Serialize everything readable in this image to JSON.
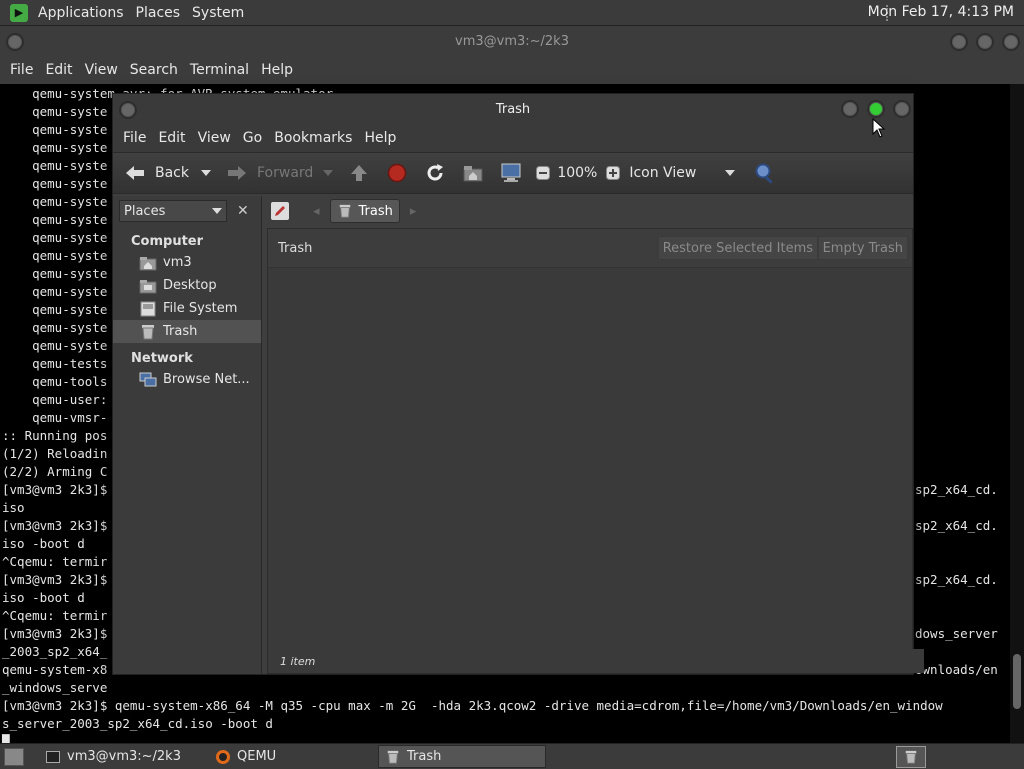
{
  "top_panel": {
    "menus": [
      "Applications",
      "Places",
      "System"
    ],
    "clock": "Mon Feb 17,  4:13 PM"
  },
  "terminal": {
    "title": "vm3@vm3:~/2k3",
    "menus": [
      "File",
      "Edit",
      "View",
      "Search",
      "Terminal",
      "Help"
    ],
    "lines_left": [
      "    qemu-system-avr: for AVR system emulator",
      "    qemu-syste",
      "    qemu-syste",
      "    qemu-syste",
      "    qemu-syste",
      "    qemu-syste",
      "    qemu-syste",
      "    qemu-syste",
      "    qemu-syste",
      "    qemu-syste",
      "    qemu-syste",
      "    qemu-syste",
      "    qemu-syste",
      "    qemu-syste",
      "    qemu-syste",
      "    qemu-tests",
      "    qemu-tools",
      "    qemu-user:",
      "    qemu-vmsr-",
      ":: Running pos",
      "(1/2) Reloadin",
      "(2/2) Arming C",
      "[vm3@vm3 2k3]$",
      "iso",
      "[vm3@vm3 2k3]$",
      "iso -boot d",
      "^Cqemu: termir",
      "[vm3@vm3 2k3]$",
      "iso -boot d",
      "^Cqemu: termir",
      "[vm3@vm3 2k3]$",
      "_2003_sp2_x64_",
      "qemu-system-x8",
      "_windows_serve"
    ],
    "lines_right": [
      {
        "row": 22,
        "text": "sp2_x64_cd."
      },
      {
        "row": 24,
        "text": "sp2_x64_cd."
      },
      {
        "row": 27,
        "text": "sp2_x64_cd."
      },
      {
        "row": 30,
        "text": "dows_server"
      },
      {
        "row": 32,
        "text": "ownloads/en"
      }
    ],
    "full_lines": [
      "[vm3@vm3 2k3]$ qemu-system-x86_64 -M q35 -cpu max -m 2G  -hda 2k3.qcow2 -drive media=cdrom,file=/home/vm3/Downloads/en_window",
      "s_server_2003_sp2_x64_cd.iso -boot d",
      "█"
    ]
  },
  "nautilus": {
    "title": "Trash",
    "menus": [
      "File",
      "Edit",
      "View",
      "Go",
      "Bookmarks",
      "Help"
    ],
    "toolbar": {
      "back": "Back",
      "forward": "Forward",
      "zoom": "100%",
      "view_mode": "Icon View"
    },
    "sidebar": {
      "selector": "Places",
      "sections": [
        {
          "heading": "Computer",
          "items": [
            {
              "label": "vm3",
              "icon": "home-folder-icon"
            },
            {
              "label": "Desktop",
              "icon": "desktop-folder-icon"
            },
            {
              "label": "File System",
              "icon": "drive-icon"
            },
            {
              "label": "Trash",
              "icon": "trash-icon",
              "selected": true
            }
          ]
        },
        {
          "heading": "Network",
          "items": [
            {
              "label": "Browse Net...",
              "icon": "network-icon"
            }
          ]
        }
      ]
    },
    "breadcrumb": "Trash",
    "trash_bar": {
      "title": "Trash",
      "restore": "Restore Selected Items",
      "empty": "Empty Trash"
    },
    "status": "1 item"
  },
  "taskbar": {
    "tasks": [
      {
        "label": "vm3@vm3:~/2k3",
        "icon": "terminal-icon"
      },
      {
        "label": "QEMU",
        "icon": "qemu-icon"
      },
      {
        "label": "Trash",
        "icon": "trash-icon",
        "active": true
      }
    ]
  },
  "colors": {
    "panel": "#3b3b3b",
    "terminal_bg": "#000000",
    "window_bg": "#3e3e3e",
    "stop_red": "#c0392b",
    "maximize_green": "#33cc33"
  }
}
